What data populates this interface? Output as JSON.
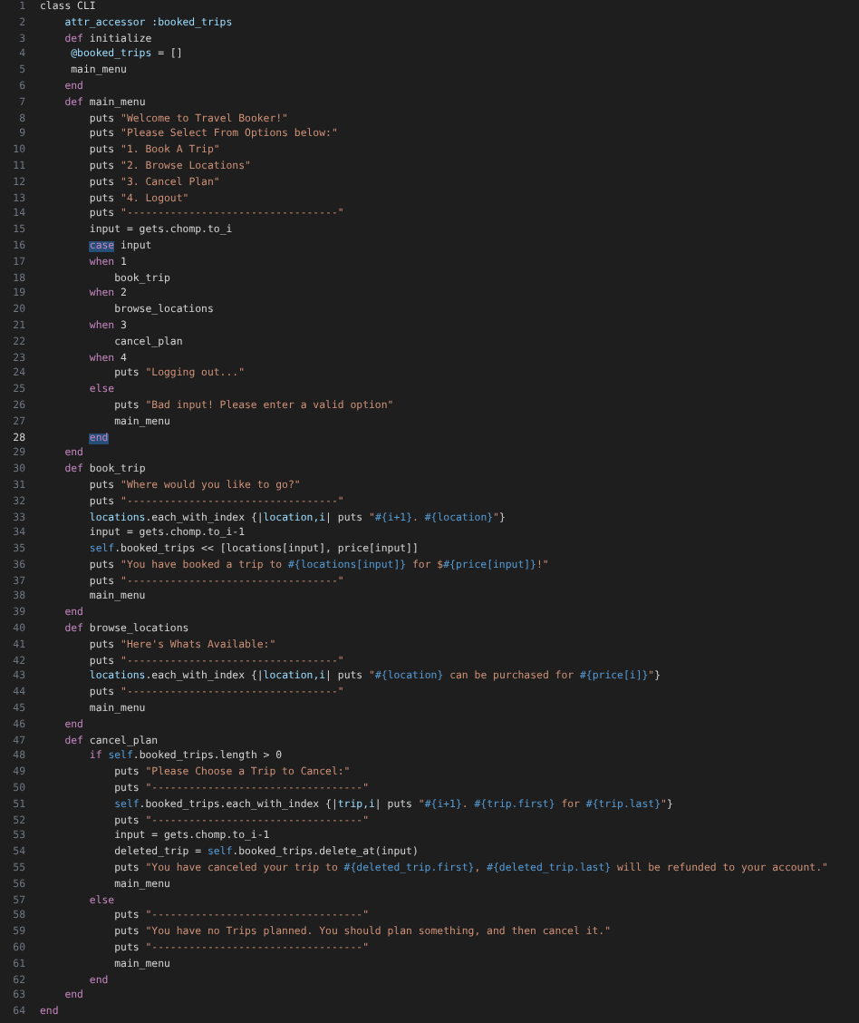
{
  "editor": {
    "lines": [
      {
        "number": "1",
        "current": false,
        "code": [
          {
            "text": "class CLI",
            "kind": "plain"
          }
        ]
      },
      {
        "number": "2",
        "current": false,
        "code": [
          {
            "text": "    attr_accessor :booked_trips",
            "kind": "var"
          }
        ]
      },
      {
        "number": "3",
        "current": false,
        "code": [
          {
            "text": "    def",
            "kind": "kw"
          },
          {
            "text": " initialize",
            "kind": "plain"
          }
        ]
      },
      {
        "number": "4",
        "current": false,
        "code": [
          {
            "text": "     @booked_trips",
            "kind": "var"
          },
          {
            "text": " = []",
            "kind": "plain"
          }
        ]
      },
      {
        "number": "5",
        "current": false,
        "code": [
          {
            "text": "     main_menu",
            "kind": "plain"
          }
        ]
      },
      {
        "number": "6",
        "current": false,
        "code": [
          {
            "text": "    end",
            "kind": "kw"
          }
        ]
      },
      {
        "number": "7",
        "current": false,
        "code": [
          {
            "text": "    def",
            "kind": "kw"
          },
          {
            "text": " main_menu",
            "kind": "plain"
          }
        ]
      },
      {
        "number": "8",
        "current": false,
        "code": [
          {
            "text": "        puts ",
            "kind": "plain"
          },
          {
            "text": "\"Welcome to Travel Booker!\"",
            "kind": "str"
          }
        ]
      },
      {
        "number": "9",
        "current": false,
        "code": [
          {
            "text": "        puts ",
            "kind": "plain"
          },
          {
            "text": "\"Please Select From Options below:\"",
            "kind": "str"
          }
        ]
      },
      {
        "number": "10",
        "current": false,
        "code": [
          {
            "text": "        puts ",
            "kind": "plain"
          },
          {
            "text": "\"1. Book A Trip\"",
            "kind": "str"
          }
        ]
      },
      {
        "number": "11",
        "current": false,
        "code": [
          {
            "text": "        puts ",
            "kind": "plain"
          },
          {
            "text": "\"2. Browse Locations\"",
            "kind": "str"
          }
        ]
      },
      {
        "number": "12",
        "current": false,
        "code": [
          {
            "text": "        puts ",
            "kind": "plain"
          },
          {
            "text": "\"3. Cancel Plan\"",
            "kind": "str"
          }
        ]
      },
      {
        "number": "13",
        "current": false,
        "code": [
          {
            "text": "        puts ",
            "kind": "plain"
          },
          {
            "text": "\"4. Logout\"",
            "kind": "str"
          }
        ]
      },
      {
        "number": "14",
        "current": false,
        "code": [
          {
            "text": "        puts ",
            "kind": "plain"
          },
          {
            "text": "\"----------------------------------\"",
            "kind": "str"
          }
        ]
      },
      {
        "number": "15",
        "current": false,
        "code": [
          {
            "text": "        input = gets.chomp.to_i",
            "kind": "plain"
          }
        ]
      },
      {
        "number": "16",
        "current": false,
        "code": [
          {
            "text": "        case",
            "kind": "match"
          },
          {
            "text": " input",
            "kind": "plain"
          }
        ]
      },
      {
        "number": "17",
        "current": false,
        "code": [
          {
            "text": "        when",
            "kind": "kw"
          },
          {
            "text": " 1",
            "kind": "plain"
          }
        ]
      },
      {
        "number": "18",
        "current": false,
        "code": [
          {
            "text": "            book_trip",
            "kind": "plain"
          }
        ]
      },
      {
        "number": "19",
        "current": false,
        "code": [
          {
            "text": "        when",
            "kind": "kw"
          },
          {
            "text": " 2",
            "kind": "plain"
          }
        ]
      },
      {
        "number": "20",
        "current": false,
        "code": [
          {
            "text": "            browse_locations",
            "kind": "plain"
          }
        ]
      },
      {
        "number": "21",
        "current": false,
        "code": [
          {
            "text": "        when",
            "kind": "kw"
          },
          {
            "text": " 3",
            "kind": "plain"
          }
        ]
      },
      {
        "number": "22",
        "current": false,
        "code": [
          {
            "text": "            cancel_plan",
            "kind": "plain"
          }
        ]
      },
      {
        "number": "23",
        "current": false,
        "code": [
          {
            "text": "        when",
            "kind": "kw"
          },
          {
            "text": " 4",
            "kind": "plain"
          }
        ]
      },
      {
        "number": "24",
        "current": false,
        "code": [
          {
            "text": "            puts ",
            "kind": "plain"
          },
          {
            "text": "\"Logging out...\"",
            "kind": "str"
          }
        ]
      },
      {
        "number": "25",
        "current": false,
        "code": [
          {
            "text": "        else",
            "kind": "kw"
          }
        ]
      },
      {
        "number": "26",
        "current": false,
        "code": [
          {
            "text": "            puts ",
            "kind": "plain"
          },
          {
            "text": "\"Bad input! Please enter a valid option\"",
            "kind": "str"
          }
        ]
      },
      {
        "number": "27",
        "current": false,
        "code": [
          {
            "text": "            main_menu",
            "kind": "plain"
          }
        ]
      },
      {
        "number": "28",
        "current": true,
        "code": [
          {
            "text": "        end",
            "kind": "match"
          }
        ]
      },
      {
        "number": "29",
        "current": false,
        "code": [
          {
            "text": "    end",
            "kind": "kw"
          }
        ]
      },
      {
        "number": "30",
        "current": false,
        "code": [
          {
            "text": "    def",
            "kind": "kw"
          },
          {
            "text": " book_trip",
            "kind": "plain"
          }
        ]
      },
      {
        "number": "31",
        "current": false,
        "code": [
          {
            "text": "        puts ",
            "kind": "plain"
          },
          {
            "text": "\"Where would you like to go?\"",
            "kind": "str"
          }
        ]
      },
      {
        "number": "32",
        "current": false,
        "code": [
          {
            "text": "        puts ",
            "kind": "plain"
          },
          {
            "text": "\"----------------------------------\"",
            "kind": "str"
          }
        ]
      },
      {
        "number": "33",
        "current": false,
        "code": [
          {
            "text": "        locations",
            "kind": "var"
          },
          {
            "text": ".each_with_index {|",
            "kind": "plain"
          },
          {
            "text": "location,i",
            "kind": "var"
          },
          {
            "text": "| puts ",
            "kind": "plain"
          },
          {
            "text": "\"",
            "kind": "str"
          },
          {
            "text": "#{i+1}",
            "kind": "interp"
          },
          {
            "text": ". ",
            "kind": "str"
          },
          {
            "text": "#{location}",
            "kind": "interp"
          },
          {
            "text": "\"",
            "kind": "str"
          },
          {
            "text": "}",
            "kind": "plain"
          }
        ]
      },
      {
        "number": "34",
        "current": false,
        "code": [
          {
            "text": "        input = gets.chomp.to_i-1",
            "kind": "plain"
          }
        ]
      },
      {
        "number": "35",
        "current": false,
        "code": [
          {
            "text": "        self",
            "kind": "self"
          },
          {
            "text": ".booked_trips << [locations[input], price[input]]",
            "kind": "plain"
          }
        ]
      },
      {
        "number": "36",
        "current": false,
        "code": [
          {
            "text": "        puts ",
            "kind": "plain"
          },
          {
            "text": "\"You have booked a trip to ",
            "kind": "str"
          },
          {
            "text": "#{locations[input]}",
            "kind": "interp"
          },
          {
            "text": " for $",
            "kind": "str"
          },
          {
            "text": "#{price[input]}",
            "kind": "interp"
          },
          {
            "text": "!\"",
            "kind": "str"
          }
        ]
      },
      {
        "number": "37",
        "current": false,
        "code": [
          {
            "text": "        puts ",
            "kind": "plain"
          },
          {
            "text": "\"----------------------------------\"",
            "kind": "str"
          }
        ]
      },
      {
        "number": "38",
        "current": false,
        "code": [
          {
            "text": "        main_menu",
            "kind": "plain"
          }
        ]
      },
      {
        "number": "39",
        "current": false,
        "code": [
          {
            "text": "    end",
            "kind": "kw"
          }
        ]
      },
      {
        "number": "40",
        "current": false,
        "code": [
          {
            "text": "    def",
            "kind": "kw"
          },
          {
            "text": " browse_locations",
            "kind": "plain"
          }
        ]
      },
      {
        "number": "41",
        "current": false,
        "code": [
          {
            "text": "        puts ",
            "kind": "plain"
          },
          {
            "text": "\"Here's Whats Available:\"",
            "kind": "str"
          }
        ]
      },
      {
        "number": "42",
        "current": false,
        "code": [
          {
            "text": "        puts ",
            "kind": "plain"
          },
          {
            "text": "\"----------------------------------\"",
            "kind": "str"
          }
        ]
      },
      {
        "number": "43",
        "current": false,
        "code": [
          {
            "text": "        locations",
            "kind": "var"
          },
          {
            "text": ".each_with_index {|",
            "kind": "plain"
          },
          {
            "text": "location,i",
            "kind": "var"
          },
          {
            "text": "| puts ",
            "kind": "plain"
          },
          {
            "text": "\"",
            "kind": "str"
          },
          {
            "text": "#{location}",
            "kind": "interp"
          },
          {
            "text": " can be purchased for ",
            "kind": "str"
          },
          {
            "text": "#{price[i]}",
            "kind": "interp"
          },
          {
            "text": "\"",
            "kind": "str"
          },
          {
            "text": "}",
            "kind": "plain"
          }
        ]
      },
      {
        "number": "44",
        "current": false,
        "code": [
          {
            "text": "        puts ",
            "kind": "plain"
          },
          {
            "text": "\"----------------------------------\"",
            "kind": "str"
          }
        ]
      },
      {
        "number": "45",
        "current": false,
        "code": [
          {
            "text": "        main_menu",
            "kind": "plain"
          }
        ]
      },
      {
        "number": "46",
        "current": false,
        "code": [
          {
            "text": "    end",
            "kind": "kw"
          }
        ]
      },
      {
        "number": "47",
        "current": false,
        "code": [
          {
            "text": "    def",
            "kind": "kw"
          },
          {
            "text": " cancel_plan",
            "kind": "plain"
          }
        ]
      },
      {
        "number": "48",
        "current": false,
        "code": [
          {
            "text": "        if ",
            "kind": "kw"
          },
          {
            "text": "self",
            "kind": "self"
          },
          {
            "text": ".booked_trips.length > 0",
            "kind": "plain"
          }
        ]
      },
      {
        "number": "49",
        "current": false,
        "code": [
          {
            "text": "            puts ",
            "kind": "plain"
          },
          {
            "text": "\"Please Choose a Trip to Cancel:\"",
            "kind": "str"
          }
        ]
      },
      {
        "number": "50",
        "current": false,
        "code": [
          {
            "text": "            puts ",
            "kind": "plain"
          },
          {
            "text": "\"----------------------------------\"",
            "kind": "str"
          }
        ]
      },
      {
        "number": "51",
        "current": false,
        "code": [
          {
            "text": "            self",
            "kind": "self"
          },
          {
            "text": ".booked_trips.each_with_index {|",
            "kind": "plain"
          },
          {
            "text": "trip,i",
            "kind": "var"
          },
          {
            "text": "| puts ",
            "kind": "plain"
          },
          {
            "text": "\"",
            "kind": "str"
          },
          {
            "text": "#{i+1}",
            "kind": "interp"
          },
          {
            "text": ". ",
            "kind": "str"
          },
          {
            "text": "#{trip.first}",
            "kind": "interp"
          },
          {
            "text": " for ",
            "kind": "str"
          },
          {
            "text": "#{trip.last}",
            "kind": "interp"
          },
          {
            "text": "\"",
            "kind": "str"
          },
          {
            "text": "}",
            "kind": "plain"
          }
        ]
      },
      {
        "number": "52",
        "current": false,
        "code": [
          {
            "text": "            puts ",
            "kind": "plain"
          },
          {
            "text": "\"----------------------------------\"",
            "kind": "str"
          }
        ]
      },
      {
        "number": "53",
        "current": false,
        "code": [
          {
            "text": "            input = gets.chomp.to_i-1",
            "kind": "plain"
          }
        ]
      },
      {
        "number": "54",
        "current": false,
        "code": [
          {
            "text": "            deleted_trip = ",
            "kind": "plain"
          },
          {
            "text": "self",
            "kind": "self"
          },
          {
            "text": ".booked_trips.delete_at(input)",
            "kind": "plain"
          }
        ]
      },
      {
        "number": "55",
        "current": false,
        "code": [
          {
            "text": "            puts ",
            "kind": "plain"
          },
          {
            "text": "\"You have canceled your trip to ",
            "kind": "str"
          },
          {
            "text": "#{deleted_trip.first}",
            "kind": "interp"
          },
          {
            "text": ", ",
            "kind": "str"
          },
          {
            "text": "#{deleted_trip.last}",
            "kind": "interp"
          },
          {
            "text": " will be refunded to your account.\"",
            "kind": "str"
          }
        ]
      },
      {
        "number": "56",
        "current": false,
        "code": [
          {
            "text": "            main_menu",
            "kind": "plain"
          }
        ]
      },
      {
        "number": "57",
        "current": false,
        "code": [
          {
            "text": "        else",
            "kind": "kw"
          }
        ]
      },
      {
        "number": "58",
        "current": false,
        "code": [
          {
            "text": "            puts ",
            "kind": "plain"
          },
          {
            "text": "\"----------------------------------\"",
            "kind": "str"
          }
        ]
      },
      {
        "number": "59",
        "current": false,
        "code": [
          {
            "text": "            puts ",
            "kind": "plain"
          },
          {
            "text": "\"You have no Trips planned. You should plan something, and then cancel it.\"",
            "kind": "str"
          }
        ]
      },
      {
        "number": "60",
        "current": false,
        "code": [
          {
            "text": "            puts ",
            "kind": "plain"
          },
          {
            "text": "\"----------------------------------\"",
            "kind": "str"
          }
        ]
      },
      {
        "number": "61",
        "current": false,
        "code": [
          {
            "text": "            main_menu",
            "kind": "plain"
          }
        ]
      },
      {
        "number": "62",
        "current": false,
        "code": [
          {
            "text": "        end",
            "kind": "kw"
          }
        ]
      },
      {
        "number": "63",
        "current": false,
        "code": [
          {
            "text": "    end",
            "kind": "kw"
          }
        ]
      },
      {
        "number": "64",
        "current": false,
        "code": [
          {
            "text": "end",
            "kind": "kw"
          }
        ]
      }
    ]
  }
}
